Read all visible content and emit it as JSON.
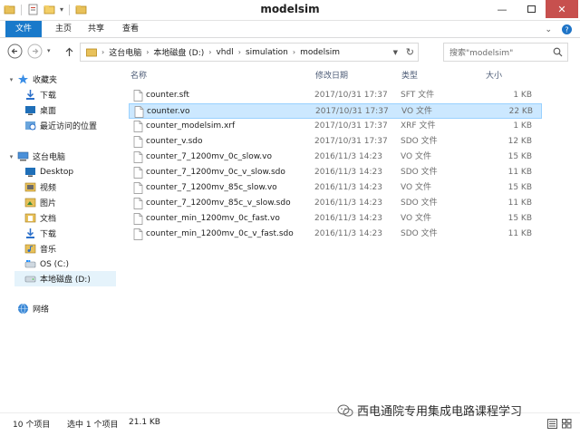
{
  "window": {
    "title": "modelsim",
    "controls": [
      "minimize",
      "maximize",
      "close"
    ]
  },
  "ribbon": {
    "tabs": [
      {
        "label": "文件",
        "active": true
      },
      {
        "label": "主页"
      },
      {
        "label": "共享"
      },
      {
        "label": "查看"
      }
    ]
  },
  "address": {
    "crumbs": [
      "这台电脑",
      "本地磁盘 (D:)",
      "vhdl",
      "simulation",
      "modelsim"
    ]
  },
  "search": {
    "placeholder": "搜索\"modelsim\""
  },
  "sidebar": {
    "favorites_label": "收藏夹",
    "favorites": [
      "下载",
      "桌面",
      "最近访问的位置"
    ],
    "pc_label": "这台电脑",
    "pc_items": [
      "Desktop",
      "视频",
      "图片",
      "文档",
      "下载",
      "音乐",
      "OS (C:)",
      "本地磁盘 (D:)"
    ],
    "network_label": "网络"
  },
  "columns": {
    "name": "名称",
    "date": "修改日期",
    "type": "类型",
    "size": "大小"
  },
  "files": [
    {
      "name": "counter.sft",
      "date": "2017/10/31 17:37",
      "type": "SFT 文件",
      "size": "1 KB"
    },
    {
      "name": "counter.vo",
      "date": "2017/10/31 17:37",
      "type": "VO 文件",
      "size": "22 KB",
      "selected": true
    },
    {
      "name": "counter_modelsim.xrf",
      "date": "2017/10/31 17:37",
      "type": "XRF 文件",
      "size": "1 KB"
    },
    {
      "name": "counter_v.sdo",
      "date": "2017/10/31 17:37",
      "type": "SDO 文件",
      "size": "12 KB"
    },
    {
      "name": "counter_7_1200mv_0c_slow.vo",
      "date": "2016/11/3 14:23",
      "type": "VO 文件",
      "size": "15 KB"
    },
    {
      "name": "counter_7_1200mv_0c_v_slow.sdo",
      "date": "2016/11/3 14:23",
      "type": "SDO 文件",
      "size": "11 KB"
    },
    {
      "name": "counter_7_1200mv_85c_slow.vo",
      "date": "2016/11/3 14:23",
      "type": "VO 文件",
      "size": "15 KB"
    },
    {
      "name": "counter_7_1200mv_85c_v_slow.sdo",
      "date": "2016/11/3 14:23",
      "type": "SDO 文件",
      "size": "11 KB"
    },
    {
      "name": "counter_min_1200mv_0c_fast.vo",
      "date": "2016/11/3 14:23",
      "type": "VO 文件",
      "size": "15 KB"
    },
    {
      "name": "counter_min_1200mv_0c_v_fast.sdo",
      "date": "2016/11/3 14:23",
      "type": "SDO 文件",
      "size": "11 KB"
    }
  ],
  "status": {
    "count": "10 个项目",
    "selection": "选中 1 个项目",
    "selection_size": "21.1 KB"
  },
  "watermark": "西电通院专用集成电路课程学习",
  "colors": {
    "file_tab": "#1979ca",
    "selection_bg": "#cce8ff",
    "selection_border": "#99d1ff",
    "close_button": "#c7504e"
  }
}
